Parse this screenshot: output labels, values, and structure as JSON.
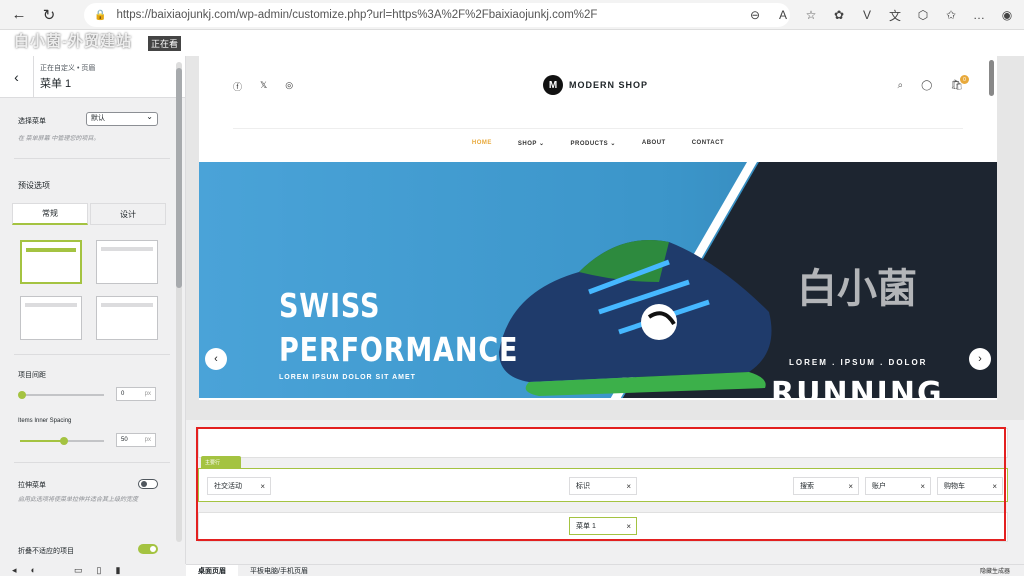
{
  "browser": {
    "url": "https://baixiaojunkj.com/wp-admin/customize.php?url=https%3A%2F%2Fbaixiaojunkj.com%2F"
  },
  "watermark": {
    "top_text": "白小菌-外贸建站",
    "tag": "正在看",
    "hero_mark": "白小菌"
  },
  "sidebar": {
    "breadcrumb": "正在自定义 • 页眉",
    "title": "菜单 1",
    "select_menu_label": "选择菜单",
    "select_menu_value": "默认",
    "select_menu_desc": "在 菜单屏幕 中管理您的项目。",
    "preset_label": "预设选项",
    "tabs": [
      "常规",
      "设计"
    ],
    "item_spacing_label": "项目间距",
    "item_spacing_value": "0",
    "item_spacing_unit": "px",
    "inner_spacing_label": "Items Inner Spacing",
    "inner_spacing_value": "50",
    "inner_spacing_unit": "px",
    "stretch_label": "拉伸菜单",
    "stretch_desc": "启用此选项将使菜单拉伸并适合其上级的宽度",
    "collapse_label": "折叠不适应的项目",
    "collapse_on": true,
    "accent": "#a4c341"
  },
  "site": {
    "brand_initial": "M",
    "brand": "MODERN SHOP",
    "cart_count": "0",
    "menu": [
      {
        "label": "HOME",
        "active": true
      },
      {
        "label": "SHOP ⌄",
        "active": false
      },
      {
        "label": "PRODUCTS ⌄",
        "active": false
      },
      {
        "label": "ABOUT",
        "active": false
      },
      {
        "label": "CONTACT",
        "active": false
      }
    ],
    "hero": {
      "line1": "SWISS",
      "line2": "PERFORMANCE",
      "sub": "LOREM IPSUM DOLOR SIT AMET",
      "right_sub": "LOREM  .  IPSUM  .  DOLOR",
      "right_title": "RUNNING"
    }
  },
  "builder": {
    "row_tag": "主要行",
    "items": {
      "social": "社交活动",
      "logo": "标识",
      "search": "搜索",
      "account": "账户",
      "cart": "购物车",
      "menu1": "菜单 1"
    },
    "close_glyph": "×"
  },
  "footer": {
    "desktop": "桌面页眉",
    "tablet": "平板电脑/手机页眉",
    "hide": "隐藏生成器"
  }
}
